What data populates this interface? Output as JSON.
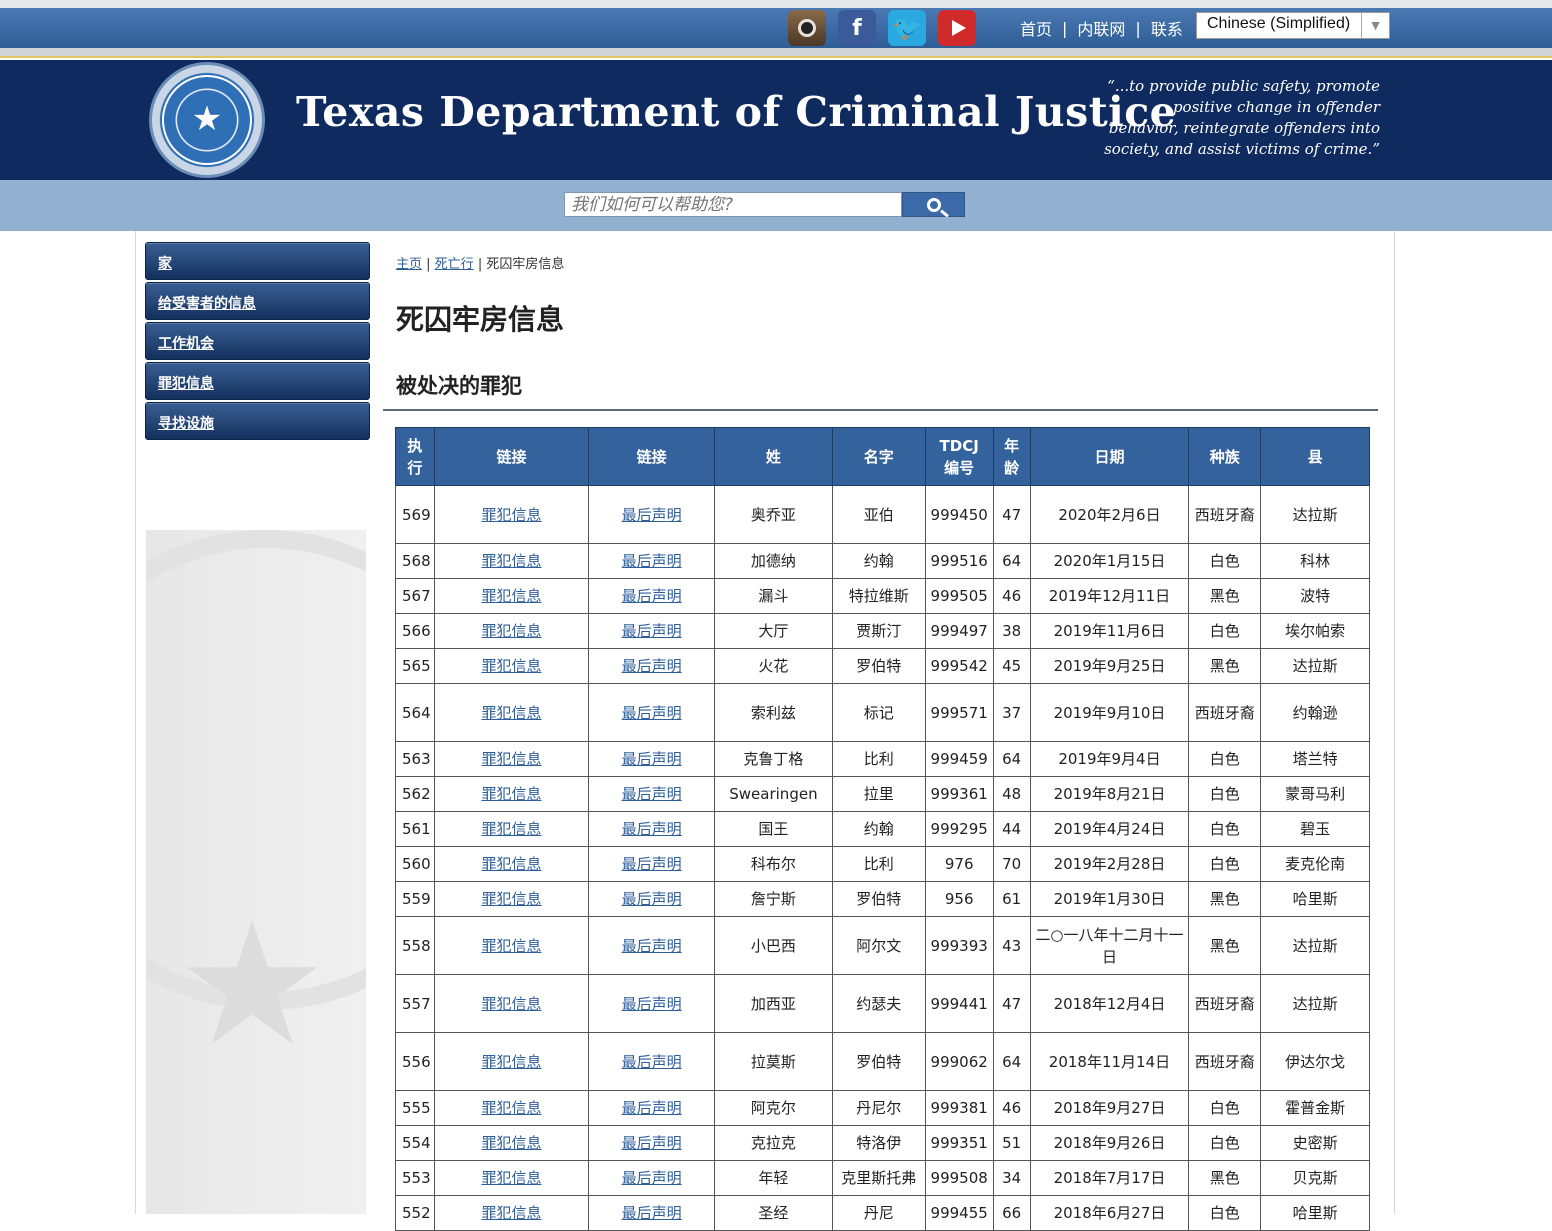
{
  "topbar": {
    "social": [
      "instagram-icon",
      "facebook-icon",
      "twitter-icon",
      "youtube-icon"
    ],
    "links": [
      "首页",
      "内联网",
      "联系"
    ],
    "language": "Chinese (Simplified)"
  },
  "banner": {
    "title": "Texas Department of Criminal Justice",
    "mission": "“...to provide public safety, promote positive change in offender behavior, reintegrate offenders into society, and assist victims of crime.”"
  },
  "search": {
    "placeholder": "我们如何可以帮助您?"
  },
  "nav": [
    "家",
    "给受害者的信息",
    "工作机会",
    "罪犯信息",
    "寻找设施"
  ],
  "breadcrumb": [
    "主页",
    "死亡行",
    "死囚牢房信息"
  ],
  "page_title": "死囚牢房信息",
  "section_title": "被处决的罪犯",
  "table": {
    "headers": [
      "执行",
      "链接",
      "链接",
      "姓",
      "名字",
      "TDCJ 编号",
      "年龄",
      "日期",
      "种族",
      "县"
    ],
    "link1": "罪犯信息",
    "link2": "最后声明",
    "rows": [
      [
        "569",
        "奥乔亚",
        "亚伯",
        "999450",
        "47",
        "2020年2月6日",
        "西班牙裔",
        "达拉斯"
      ],
      [
        "568",
        "加德纳",
        "约翰",
        "999516",
        "64",
        "2020年1月15日",
        "白色",
        "科林"
      ],
      [
        "567",
        "漏斗",
        "特拉维斯",
        "999505",
        "46",
        "2019年12月11日",
        "黑色",
        "波特"
      ],
      [
        "566",
        "大厅",
        "贾斯汀",
        "999497",
        "38",
        "2019年11月6日",
        "白色",
        "埃尔帕索"
      ],
      [
        "565",
        "火花",
        "罗伯特",
        "999542",
        "45",
        "2019年9月25日",
        "黑色",
        "达拉斯"
      ],
      [
        "564",
        "索利兹",
        "标记",
        "999571",
        "37",
        "2019年9月10日",
        "西班牙裔",
        "约翰逊"
      ],
      [
        "563",
        "克鲁丁格",
        "比利",
        "999459",
        "64",
        "2019年9月4日",
        "白色",
        "塔兰特"
      ],
      [
        "562",
        "Swearingen",
        "拉里",
        "999361",
        "48",
        "2019年8月21日",
        "白色",
        "蒙哥马利"
      ],
      [
        "561",
        "国王",
        "约翰",
        "999295",
        "44",
        "2019年4月24日",
        "白色",
        "碧玉"
      ],
      [
        "560",
        "科布尔",
        "比利",
        "976",
        "70",
        "2019年2月28日",
        "白色",
        "麦克伦南"
      ],
      [
        "559",
        "詹宁斯",
        "罗伯特",
        "956",
        "61",
        "2019年1月30日",
        "黑色",
        "哈里斯"
      ],
      [
        "558",
        "小巴西",
        "阿尔文",
        "999393",
        "43",
        "二○一八年十二月十一日",
        "黑色",
        "达拉斯"
      ],
      [
        "557",
        "加西亚",
        "约瑟夫",
        "999441",
        "47",
        "2018年12月4日",
        "西班牙裔",
        "达拉斯"
      ],
      [
        "556",
        "拉莫斯",
        "罗伯特",
        "999062",
        "64",
        "2018年11月14日",
        "西班牙裔",
        "伊达尔戈"
      ],
      [
        "555",
        "阿克尔",
        "丹尼尔",
        "999381",
        "46",
        "2018年9月27日",
        "白色",
        "霍普金斯"
      ],
      [
        "554",
        "克拉克",
        "特洛伊",
        "999351",
        "51",
        "2018年9月26日",
        "白色",
        "史密斯"
      ],
      [
        "553",
        "年轻",
        "克里斯托弗",
        "999508",
        "34",
        "2018年7月17日",
        "黑色",
        "贝克斯"
      ],
      [
        "552",
        "圣经",
        "丹尼",
        "999455",
        "66",
        "2018年6月27日",
        "白色",
        "哈里斯"
      ]
    ],
    "tall_rows": [
      0,
      5,
      11,
      12,
      13
    ]
  }
}
